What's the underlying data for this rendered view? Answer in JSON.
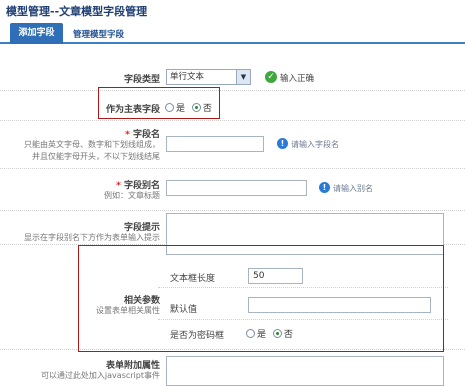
{
  "page_title": "模型管理--文章模型字段管理",
  "tabs": {
    "active": "添加字段",
    "manage": "管理模型字段"
  },
  "field_type": {
    "label": "字段类型",
    "value": "单行文本",
    "status": "输入正确"
  },
  "primary_field": {
    "label": "作为主表字段",
    "yes": "是",
    "no": "否",
    "selected": "否"
  },
  "field_name": {
    "label": "字段名",
    "required_mark": "*",
    "desc1": "只能由英文字母、数字和下划线组成，",
    "desc2": "并且仅能字母开头，不以下划线结尾",
    "value": "",
    "hint": "请输入字段名"
  },
  "field_alias": {
    "label": "字段别名",
    "required_mark": "*",
    "desc": "例如：文章标题",
    "value": "",
    "hint": "请输入别名"
  },
  "field_tip": {
    "label": "字段提示",
    "desc": "显示在字段别名下方作为表单输入提示",
    "value": ""
  },
  "related_params": {
    "label": "相关参数",
    "desc": "设置表单相关属性",
    "text_length": {
      "label": "文本框长度",
      "value": "50"
    },
    "default_value": {
      "label": "默认值",
      "value": ""
    },
    "is_password": {
      "label": "是否为密码框",
      "yes": "是",
      "no": "否",
      "selected": "否"
    }
  },
  "form_extra": {
    "label": "表单附加属性",
    "desc": "可以通过此处加入javascript事件"
  }
}
